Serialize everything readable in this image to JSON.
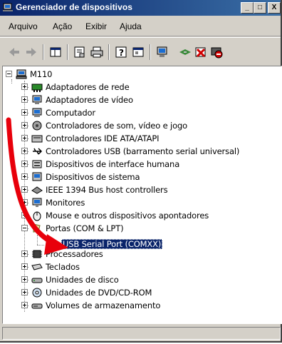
{
  "window": {
    "title": "Gerenciador de dispositivos",
    "minimize_label": "_",
    "maximize_label": "□",
    "close_label": "X"
  },
  "menu": [
    {
      "label": "Arquivo"
    },
    {
      "label": "Ação"
    },
    {
      "label": "Exibir"
    },
    {
      "label": "Ajuda"
    }
  ],
  "toolbar": {
    "icons": [
      "back-arrow-icon",
      "forward-arrow-icon",
      "properties-view-icon",
      "properties-icon",
      "print-icon",
      "help-icon",
      "view-icon",
      "scan-hardware-icon",
      "uninstall-icon",
      "disable-icon",
      "update-driver-icon"
    ]
  },
  "tree": {
    "root": "M110",
    "items": [
      {
        "label": "Adaptadores de rede",
        "icon": "network-adapter-icon"
      },
      {
        "label": "Adaptadores de vídeo",
        "icon": "display-adapter-icon"
      },
      {
        "label": "Computador",
        "icon": "computer-icon"
      },
      {
        "label": "Controladores de som, vídeo e jogo",
        "icon": "sound-icon"
      },
      {
        "label": "Controladores IDE ATA/ATAPI",
        "icon": "ide-controller-icon"
      },
      {
        "label": "Controladores USB (barramento serial universal)",
        "icon": "usb-icon"
      },
      {
        "label": "Dispositivos de interface humana",
        "icon": "hid-icon"
      },
      {
        "label": "Dispositivos de sistema",
        "icon": "system-device-icon"
      },
      {
        "label": "IEEE 1394 Bus host controllers",
        "icon": "firewire-icon"
      },
      {
        "label": "Monitores",
        "icon": "monitor-icon"
      },
      {
        "label": "Mouse e outros dispositivos apontadores",
        "icon": "mouse-icon"
      },
      {
        "label": "Portas (COM & LPT)",
        "icon": "port-icon"
      },
      {
        "label": "Processadores",
        "icon": "processor-icon"
      },
      {
        "label": "Teclados",
        "icon": "keyboard-icon"
      },
      {
        "label": "Unidades de disco",
        "icon": "disk-drive-icon"
      },
      {
        "label": "Unidades de DVD/CD-ROM",
        "icon": "dvd-drive-icon"
      },
      {
        "label": "Volumes de armazenamento",
        "icon": "storage-volume-icon"
      }
    ],
    "selected_child": {
      "label": "USB Serial Port (COMXX)",
      "icon": "serial-port-icon",
      "parent": "Portas (COM & LPT)"
    }
  },
  "colors": {
    "title_gradient_start": "#0a246a",
    "title_gradient_end": "#3a6ea5",
    "selection": "#0a246a",
    "annotation_arrow": "#e8000b"
  }
}
